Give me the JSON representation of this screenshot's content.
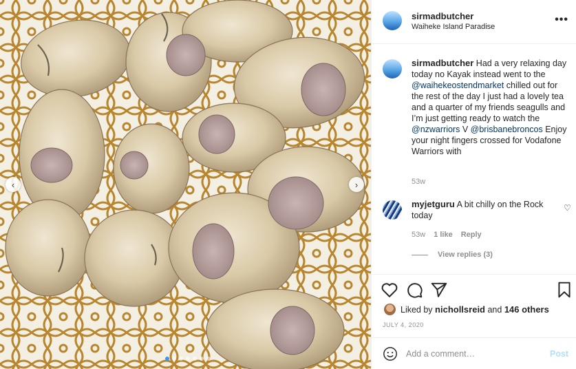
{
  "post": {
    "owner": "sirmadbutcher",
    "location": "Waiheke Island Paradise",
    "more_glyph": "•••"
  },
  "caption": {
    "username": "sirmadbutcher",
    "text_1": "Had a very relaxing day today no Kayak instead went to the ",
    "mention_1": "@waihekeostendmarket",
    "text_2": " chilled out for the rest of the day I just had a lovely tea and a quarter of my friends seagulls and I’m just getting ready to watch the ",
    "mention_2": "@nzwarriors",
    "text_3": " V ",
    "mention_3": "@brisbanebroncos",
    "text_4": " Enjoy your night fingers crossed for Vodafone Warriors with",
    "time": "53w"
  },
  "comment": {
    "username": "myjetguru",
    "text": "A bit chilly on the Rock today",
    "time": "53w",
    "likes": "1 like",
    "reply_label": "Reply",
    "view_replies": "View replies (3)"
  },
  "likes": {
    "prefix": "Liked by ",
    "liker": "nichollsreid",
    "middle": " and ",
    "others": "146 others"
  },
  "date": "JULY 4, 2020",
  "add_comment": {
    "placeholder": "Add a comment…",
    "post_label": "Post"
  },
  "carousel": {
    "prev_glyph": "‹",
    "next_glyph": "›",
    "dot_count": 7,
    "active_index": 0
  },
  "icons": {
    "heart": "heart-icon",
    "comment": "comment-icon",
    "share": "share-icon",
    "bookmark": "bookmark-icon",
    "emoji": "emoji-icon",
    "heart_small_glyph": "♡"
  },
  "colors": {
    "link": "#00376b",
    "muted": "#8e8e8e",
    "post_button": "#b2dffc",
    "active_dot": "#3897f0"
  }
}
